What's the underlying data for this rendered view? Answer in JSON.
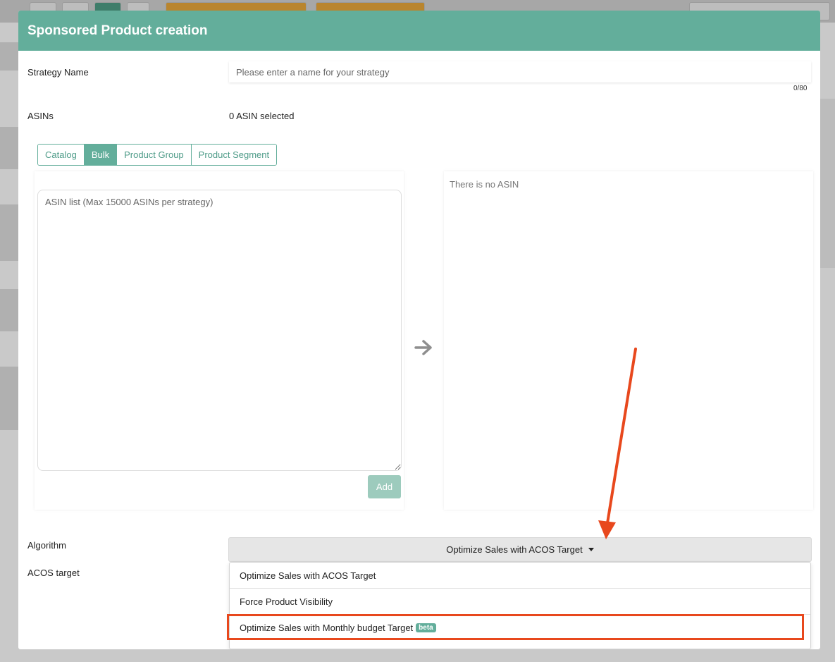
{
  "modal": {
    "title": "Sponsored Product creation"
  },
  "form": {
    "strategy_name_label": "Strategy Name",
    "strategy_name_placeholder": "Please enter a name for your strategy",
    "strategy_name_counter": "0/80",
    "asins_label": "ASINs",
    "asins_selected": "0 ASIN selected",
    "algorithm_label": "Algorithm",
    "acos_label": "ACOS target"
  },
  "tabs": [
    {
      "label": "Catalog",
      "active": false
    },
    {
      "label": "Bulk",
      "active": true
    },
    {
      "label": "Product Group",
      "active": false
    },
    {
      "label": "Product Segment",
      "active": false
    }
  ],
  "bulk": {
    "textarea_placeholder": "ASIN list (Max 15000 ASINs per strategy)",
    "add_label": "Add",
    "empty_list_text": "There is no ASIN"
  },
  "algorithm": {
    "selected": "Optimize Sales with ACOS Target",
    "options": [
      {
        "label": "Optimize Sales with ACOS Target"
      },
      {
        "label": "Force Product Visibility"
      },
      {
        "label": "Optimize Sales with Monthly budget Target",
        "badge": "beta"
      }
    ]
  },
  "colors": {
    "header": "#63ae9b",
    "annotation": "#e8481d"
  }
}
